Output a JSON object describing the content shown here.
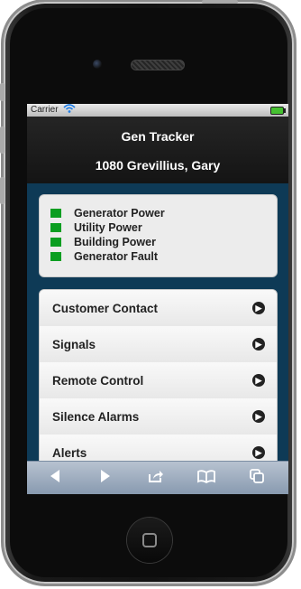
{
  "status_bar": {
    "carrier": "Carrier",
    "wifi_icon": "wifi-icon",
    "battery_icon": "battery-icon"
  },
  "header": {
    "title": "Gen Tracker",
    "address": "1080 Grevillius, Gary"
  },
  "status_panel": {
    "indicator_color": "#0b9e21",
    "items": [
      {
        "label": "Generator Power"
      },
      {
        "label": "Utility Power"
      },
      {
        "label": "Building Power"
      },
      {
        "label": "Generator Fault"
      }
    ]
  },
  "menu": {
    "items": [
      {
        "label": "Customer Contact",
        "icon": "chevron-right-circle-icon"
      },
      {
        "label": "Signals",
        "icon": "chevron-right-circle-icon"
      },
      {
        "label": "Remote Control",
        "icon": "chevron-right-circle-icon"
      },
      {
        "label": "Silence Alarms",
        "icon": "chevron-right-circle-icon"
      },
      {
        "label": "Alerts",
        "icon": "chevron-right-circle-icon"
      }
    ]
  },
  "toolbar": {
    "icons": [
      "back-icon",
      "forward-icon",
      "share-icon",
      "bookmarks-icon",
      "tabs-icon"
    ]
  },
  "colors": {
    "screen_background": "#0e3a56",
    "header_background": "#1c1c1c",
    "indicator_green": "#0b9e21"
  }
}
